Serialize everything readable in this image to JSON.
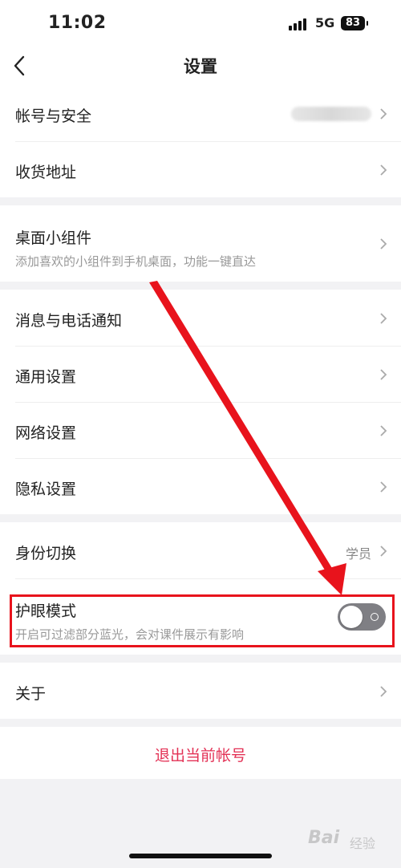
{
  "status_bar": {
    "time": "11:02",
    "network": "5G",
    "battery": "83"
  },
  "header": {
    "title": "设置",
    "back_icon": "chevron-left-icon"
  },
  "groups": {
    "account": {
      "items": [
        {
          "label": "帐号与安全"
        },
        {
          "label": "收货地址"
        }
      ]
    },
    "widget": {
      "label": "桌面小组件",
      "subtitle": "添加喜欢的小组件到手机桌面，功能一键直达"
    },
    "settings": {
      "items": [
        {
          "label": "消息与电话通知"
        },
        {
          "label": "通用设置"
        },
        {
          "label": "网络设置"
        },
        {
          "label": "隐私设置"
        }
      ]
    },
    "identity": {
      "label": "身份切换",
      "value": "学员"
    },
    "eye_care": {
      "label": "护眼模式",
      "subtitle": "开启可过滤部分蓝光，会对课件展示有影响",
      "enabled": false
    },
    "about": {
      "label": "关于"
    }
  },
  "logout": {
    "label": "退出当前帐号"
  },
  "watermark": {
    "text": "Bai",
    "sub": "经验"
  },
  "colors": {
    "accent_red": "#e33155",
    "highlight": "#e8131c",
    "toggle_off": "#7f7f84"
  }
}
